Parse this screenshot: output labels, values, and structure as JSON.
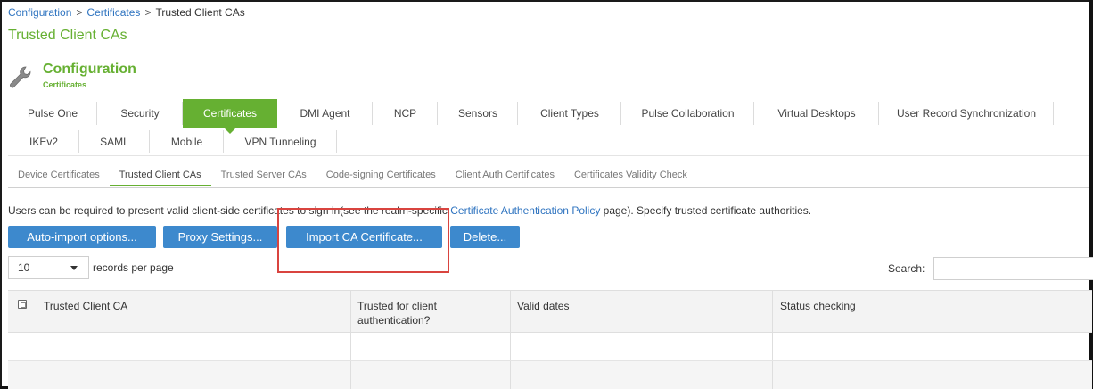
{
  "breadcrumb": {
    "items": [
      "Configuration",
      "Certificates",
      "Trusted Client CAs"
    ],
    "separator": ">"
  },
  "page_title": "Trusted Client CAs",
  "section": {
    "title": "Configuration",
    "subtitle": "Certificates",
    "icon": "wrench-icon"
  },
  "tabs_row1": [
    {
      "label": "Pulse One"
    },
    {
      "label": "Security"
    },
    {
      "label": "Certificates",
      "active": true
    },
    {
      "label": "DMI Agent"
    },
    {
      "label": "NCP"
    },
    {
      "label": "Sensors"
    },
    {
      "label": "Client Types"
    },
    {
      "label": "Pulse Collaboration"
    },
    {
      "label": "Virtual Desktops"
    },
    {
      "label": "User Record Synchronization"
    }
  ],
  "tabs_row2": [
    {
      "label": "IKEv2"
    },
    {
      "label": "SAML"
    },
    {
      "label": "Mobile"
    },
    {
      "label": "VPN Tunneling"
    }
  ],
  "subtabs": [
    {
      "label": "Device Certificates"
    },
    {
      "label": "Trusted Client CAs",
      "active": true
    },
    {
      "label": "Trusted Server CAs"
    },
    {
      "label": "Code-signing Certificates"
    },
    {
      "label": "Client Auth Certificates"
    },
    {
      "label": "Certificates Validity Check"
    }
  ],
  "info": {
    "prefix": "Users can be required to present valid client-side certificates to sign in(see the realm-specific ",
    "link": "Certificate Authentication Policy",
    "suffix": " page). Specify trusted certificate authorities."
  },
  "buttons": {
    "auto_import": "Auto-import options...",
    "proxy": "Proxy Settings...",
    "import_ca": "Import CA Certificate...",
    "delete": "Delete..."
  },
  "records": {
    "value": "10",
    "label": "records per page"
  },
  "search": {
    "label": "Search:",
    "value": ""
  },
  "table": {
    "columns": [
      "Trusted Client CA",
      "Trusted for client authentication?",
      "Valid dates",
      "Status checking"
    ],
    "rows": []
  },
  "colors": {
    "accent_green": "#66b032",
    "button_blue": "#3d89cd",
    "link_blue": "#2f74c0",
    "highlight_red": "#d9443f"
  }
}
